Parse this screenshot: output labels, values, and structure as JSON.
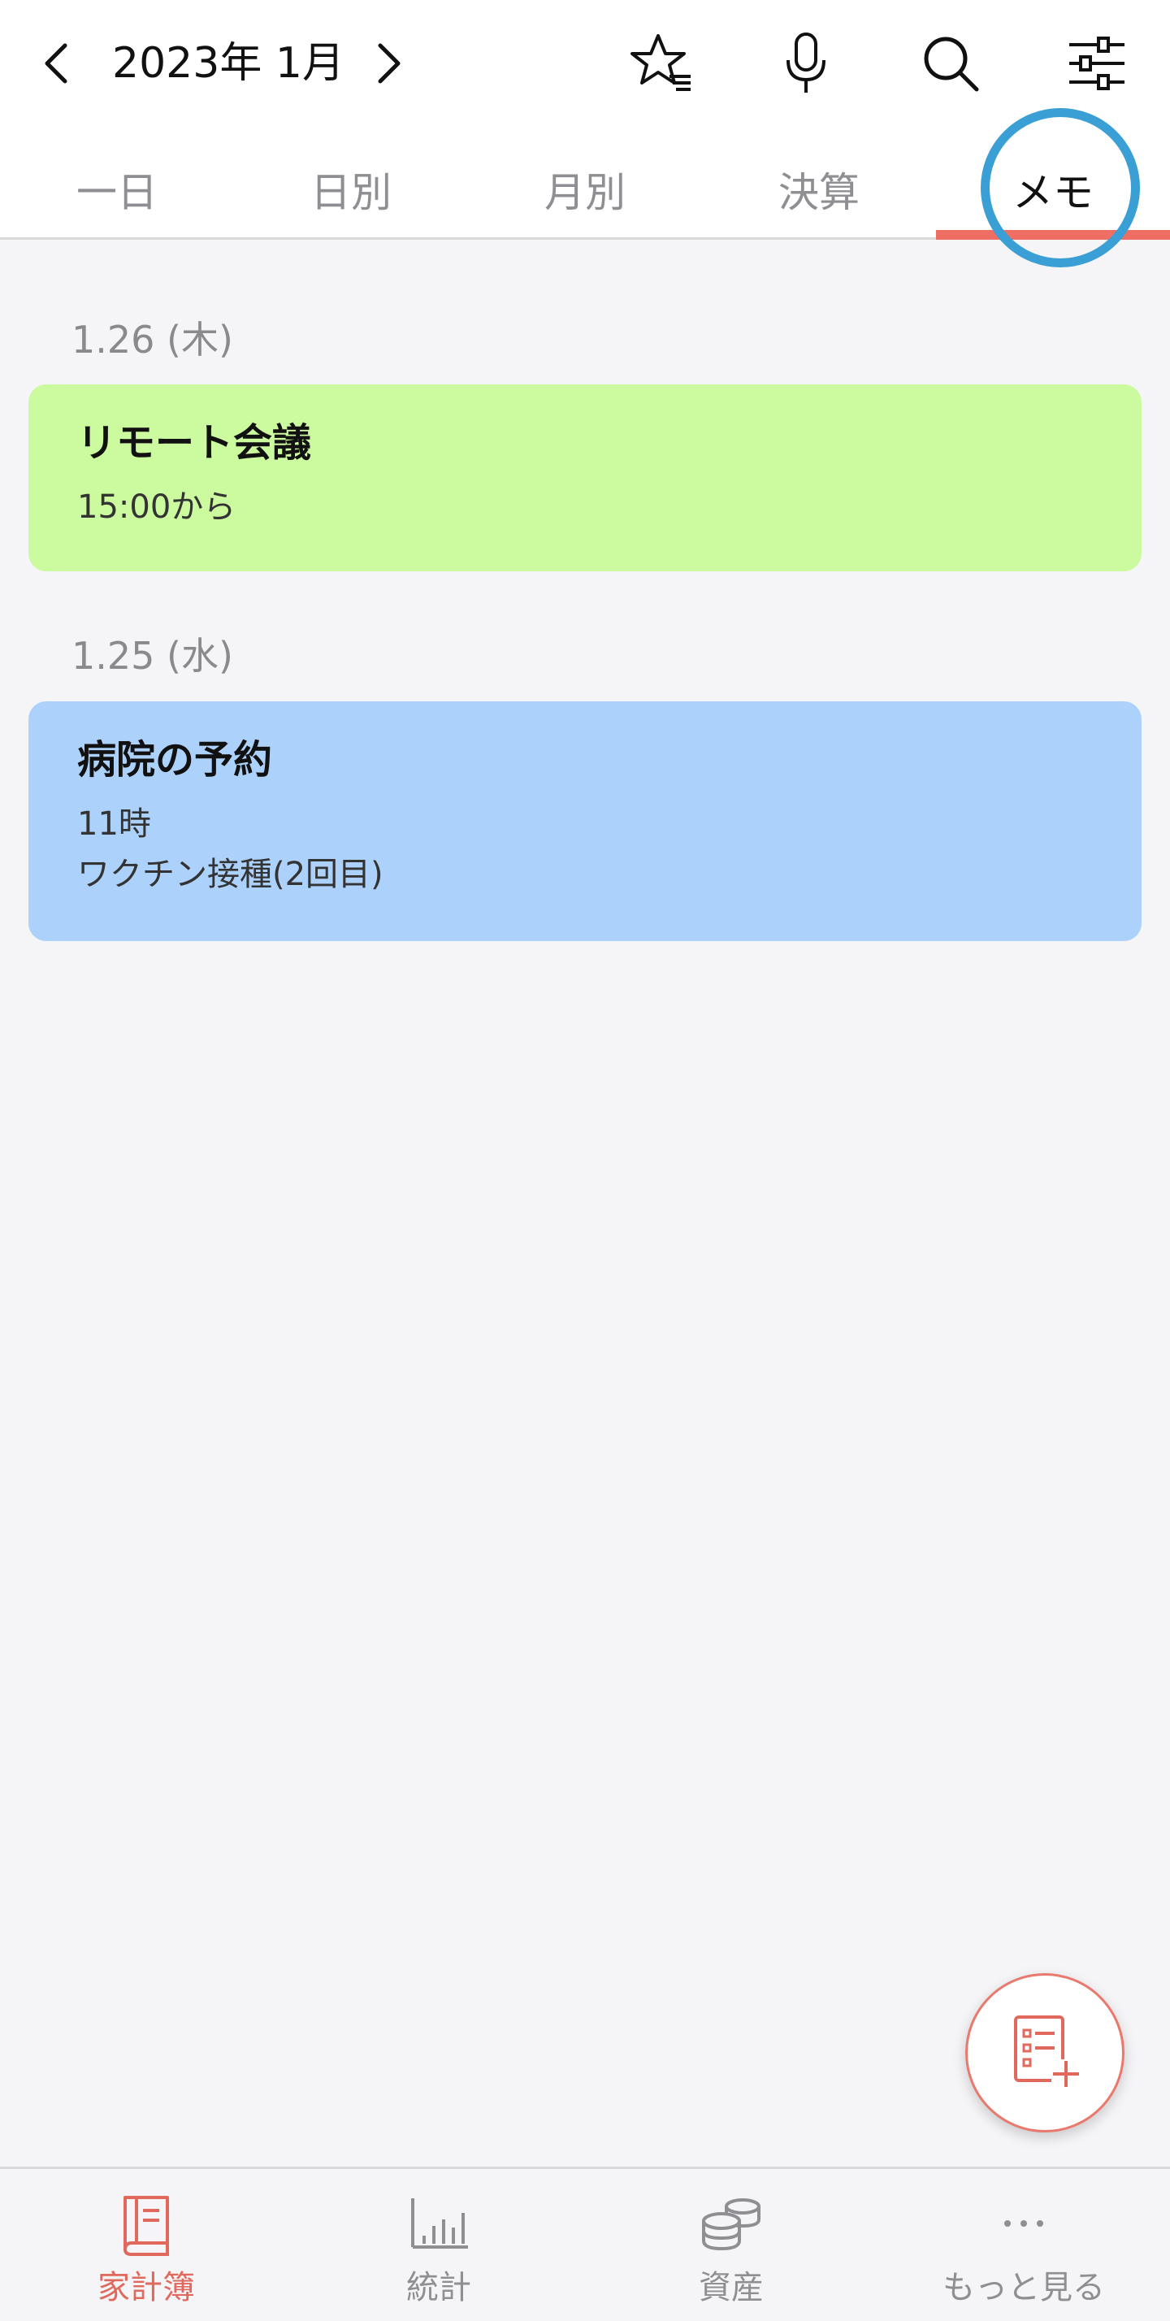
{
  "header": {
    "month_title": "2023年 1月",
    "icons": [
      "chevron-left-icon",
      "chevron-right-icon",
      "star-list-icon",
      "microphone-icon",
      "search-icon",
      "sliders-icon"
    ]
  },
  "tabs": [
    {
      "label": "一日",
      "active": false
    },
    {
      "label": "日別",
      "active": false
    },
    {
      "label": "月別",
      "active": false
    },
    {
      "label": "決算",
      "active": false
    },
    {
      "label": "メモ",
      "active": true
    }
  ],
  "memos": [
    {
      "date": "1.26 (木)",
      "title": "リモート会議",
      "lines": [
        "15:00から"
      ],
      "color": "#ccfa9f"
    },
    {
      "date": "1.25 (水)",
      "title": "病院の予約",
      "lines": [
        "11時",
        "ワクチン接種(2回目)"
      ],
      "color": "#acd1fa"
    }
  ],
  "fab": {
    "icon": "add-memo-icon"
  },
  "bottom_nav": [
    {
      "label": "家計簿",
      "icon": "book-icon",
      "active": true
    },
    {
      "label": "統計",
      "icon": "bar-chart-icon",
      "active": false
    },
    {
      "label": "資産",
      "icon": "coins-icon",
      "active": false
    },
    {
      "label": "もっと見る",
      "icon": "more-dots-icon",
      "active": false
    }
  ],
  "colors": {
    "accent": "#ee6e63",
    "highlight_circle": "#3a9fd4",
    "background": "#f5f5f7"
  }
}
